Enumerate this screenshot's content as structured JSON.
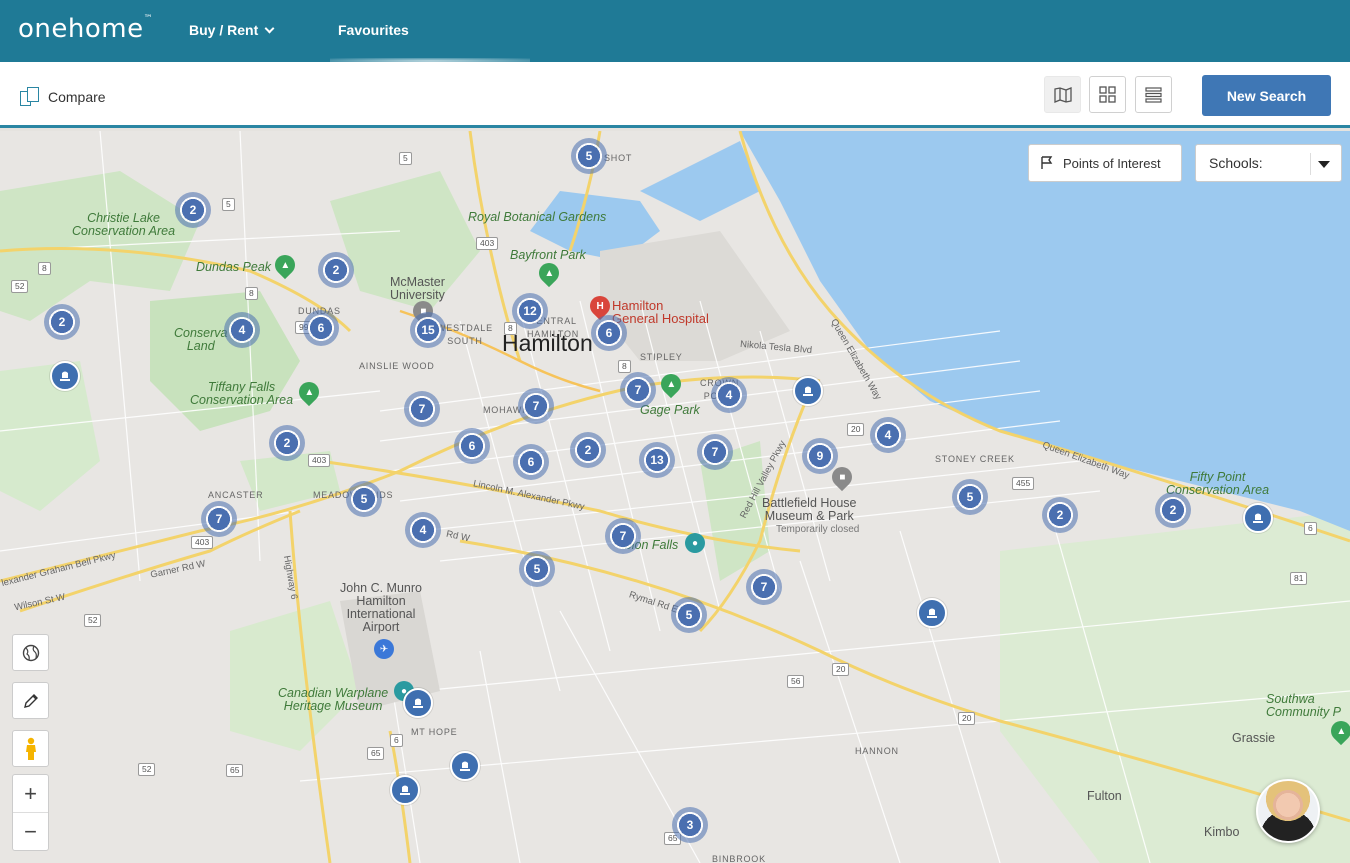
{
  "nav": {
    "logo": "onehome",
    "logo_tm": "™",
    "buy_rent": "Buy / Rent",
    "favourites": "Favourites"
  },
  "toolbar": {
    "compare": "Compare",
    "new_search": "New Search"
  },
  "map_controls": {
    "points_of_interest": "Points of Interest",
    "schools_label": "Schools:",
    "zoom_in": "+",
    "zoom_out": "−"
  },
  "labels": {
    "hamilton": "Hamilton",
    "christie_lake": "Christie Lake\nConservation Area",
    "dundas_peak": "Dundas Peak",
    "royal_botanical": "Royal Botanical Gardens",
    "bayfront_park": "Bayfront Park",
    "mcmaster": "McMaster\nUniversity",
    "hamilton_general": "Hamilton\nGeneral Hospital",
    "conservation_land": "Conserva\nLand",
    "tiffany_falls": "Tiffany Falls\nConservation Area",
    "gage_park": "Gage Park",
    "battlefield": "Battlefield House\nMuseum & Park",
    "temporarily_closed": "Temporarily closed",
    "fifty_point": "Fifty Point\nConservation Area",
    "albion_falls": "lbion Falls",
    "john_munro": "John C. Munro\nHamilton\nInternational\nAirport",
    "canadian_warplane": "Canadian Warplane\nHeritage Museum",
    "southwest_community": "Southwa\nCommunity P",
    "grassie": "Grassie",
    "fulton": "Fulton",
    "kimbo": "Kimbo",
    "dundas": "DUNDAS",
    "westdale": "WESTDALE\nSOUTH",
    "central_hamilton": "CENTRAL\nHAMILTON",
    "stipley": "STIPLEY",
    "crown_point": "CROWN\nPOINT",
    "ainslie_wood": "AINSLIE WOOD",
    "mohawk": "MOHAWK",
    "ancaster": "ANCASTER",
    "meadowlands": "MEADOWLANDS",
    "stoney_creek": "STONEY CREEK",
    "mt_hope": "MT HOPE",
    "hannon": "HANNON",
    "binbrook": "BINBROOK",
    "shot": "SHOT",
    "nikola_tesla": "Nikola Tesla Blvd",
    "queen_elizabeth_1": "Queen Elizabeth Way",
    "queen_elizabeth_2": "Queen Elizabeth Way",
    "red_hill": "Red Hill Valley Pkwy",
    "lincoln_alexander": "Lincoln M. Alexander Pkwy",
    "rymal": "Rymal Rd E",
    "garner": "Garner Rd W",
    "wilson": "Wilson St W",
    "alexander_graham": "lexander Graham Bell Pkwy",
    "highway6": "Highway 6",
    "rd_w": "Rd W"
  },
  "shields": [
    "5",
    "5",
    "403",
    "8",
    "52",
    "8",
    "99",
    "8",
    "8",
    "403",
    "403",
    "20",
    "455",
    "52",
    "56",
    "20",
    "20",
    "6",
    "65",
    "65",
    "52",
    "65",
    "81",
    "6"
  ],
  "clusters": [
    "5",
    "2",
    "2",
    "2",
    "12",
    "6",
    "15",
    "6",
    "4",
    "7",
    "7",
    "4",
    "2",
    "7",
    "6",
    "6",
    "2",
    "13",
    "7",
    "9",
    "4",
    "5",
    "7",
    "4",
    "5",
    "7",
    "5",
    "7",
    "5",
    "2",
    "2",
    "3"
  ],
  "colors": {
    "nav_bg": "#1f7a96",
    "button_blue": "#3f77b5",
    "cluster_blue": "#4a6fb0",
    "water": "#9cc9ef"
  }
}
